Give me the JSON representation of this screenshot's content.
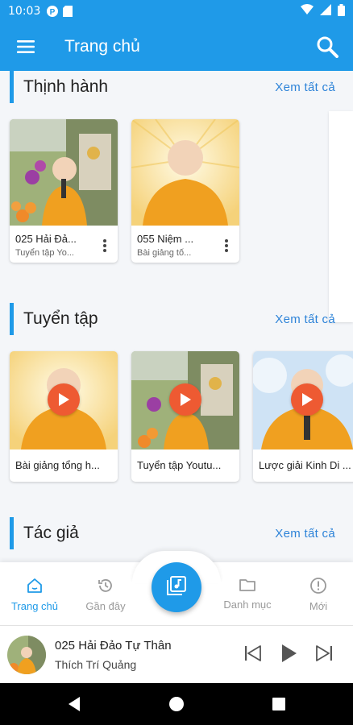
{
  "status_bar": {
    "time": "10:03",
    "icons": [
      "p-icon",
      "sd-card-icon",
      "wifi-icon",
      "signal-icon",
      "battery-icon"
    ]
  },
  "app_bar": {
    "title": "Trang chủ",
    "menu_icon": "menu-icon",
    "search_icon": "search-icon",
    "color": "#1f9ae8"
  },
  "sections": {
    "trending": {
      "title": "Thịnh hành",
      "see_all": "Xem tất cả",
      "items": [
        {
          "title": "025 Hải Đả...",
          "subtitle": "Tuyển tập Yo..."
        },
        {
          "title": "055 Niệm ...",
          "subtitle": "Bài giảng tố..."
        }
      ]
    },
    "collections": {
      "title": "Tuyển tập",
      "see_all": "Xem tất cả",
      "items": [
        {
          "title": "Bài giảng tổng h..."
        },
        {
          "title": "Tuyển tập Youtu..."
        },
        {
          "title": "Lược giải Kinh Di ..."
        }
      ]
    },
    "authors": {
      "title": "Tác giả",
      "see_all": "Xem tất cả"
    }
  },
  "bottom_nav": {
    "items": [
      {
        "label": "Trang chủ",
        "icon": "home-icon",
        "active": true
      },
      {
        "label": "Gần đây",
        "icon": "history-icon",
        "active": false
      },
      {
        "label": "Danh mục",
        "icon": "folder-icon",
        "active": false
      },
      {
        "label": "Mới",
        "icon": "alert-icon",
        "active": false
      }
    ],
    "center_icon": "music-library-icon"
  },
  "mini_player": {
    "title": "025 Hải Đảo Tự Thân",
    "artist": "Thích Trí Quảng"
  },
  "colors": {
    "primary": "#1f9ae8",
    "accent_play": "#ee5a32",
    "robe": "#f0a020"
  }
}
